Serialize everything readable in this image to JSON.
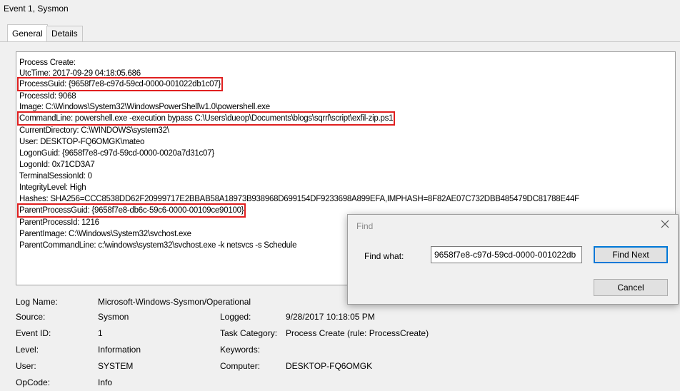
{
  "window": {
    "title": "Event 1, Sysmon"
  },
  "tabs": [
    {
      "label": "General"
    },
    {
      "label": "Details"
    }
  ],
  "event_text": {
    "lines": [
      "Process Create:",
      "UtcTime: 2017-09-29 04:18:05.686",
      "ProcessGuid: {9658f7e8-c97d-59cd-0000-001022db1c07}",
      "ProcessId: 9068",
      "Image: C:\\Windows\\System32\\WindowsPowerShell\\v1.0\\powershell.exe",
      "CommandLine: powershell.exe -execution bypass C:\\Users\\dueop\\Documents\\blogs\\sqrrl\\script\\exfil-zip.ps1",
      "CurrentDirectory: C:\\WINDOWS\\system32\\",
      "User: DESKTOP-FQ6OMGK\\mateo",
      "LogonGuid: {9658f7e8-c97d-59cd-0000-0020a7d31c07}",
      "LogonId: 0x71CD3A7",
      "TerminalSessionId: 0",
      "IntegrityLevel: High",
      "Hashes: SHA256=CCC8538DD62F20999717E2BBAB58A18973B938968D699154DF9233698A899EFA,IMPHASH=8F82AE07C732DBB485479DC81788E44F",
      "ParentProcessGuid: {9658f7e8-db6c-59c6-0000-00109ce90100}",
      "ParentProcessId: 1216",
      "ParentImage: C:\\Windows\\System32\\svchost.exe",
      "ParentCommandLine: c:\\windows\\system32\\svchost.exe -k netsvcs -s Schedule"
    ]
  },
  "meta": {
    "log_name_label": "Log Name:",
    "log_name_value": "Microsoft-Windows-Sysmon/Operational",
    "source_label": "Source:",
    "source_value": "Sysmon",
    "logged_label": "Logged:",
    "logged_value": "9/28/2017 10:18:05 PM",
    "event_id_label": "Event ID:",
    "event_id_value": "1",
    "task_category_label": "Task Category:",
    "task_category_value": "Process Create (rule: ProcessCreate)",
    "level_label": "Level:",
    "level_value": "Information",
    "keywords_label": "Keywords:",
    "keywords_value": "",
    "user_label": "User:",
    "user_value": "SYSTEM",
    "computer_label": "Computer:",
    "computer_value": "DESKTOP-FQ6OMGK",
    "opcode_label": "OpCode:",
    "opcode_value": "Info"
  },
  "find_dialog": {
    "title": "Find",
    "find_what_label": "Find what:",
    "find_what_value": "9658f7e8-c97d-59cd-0000-001022db",
    "find_next_label": "Find Next",
    "cancel_label": "Cancel"
  },
  "colors": {
    "highlight_border": "#e02020",
    "default_button_border": "#0078d7"
  }
}
